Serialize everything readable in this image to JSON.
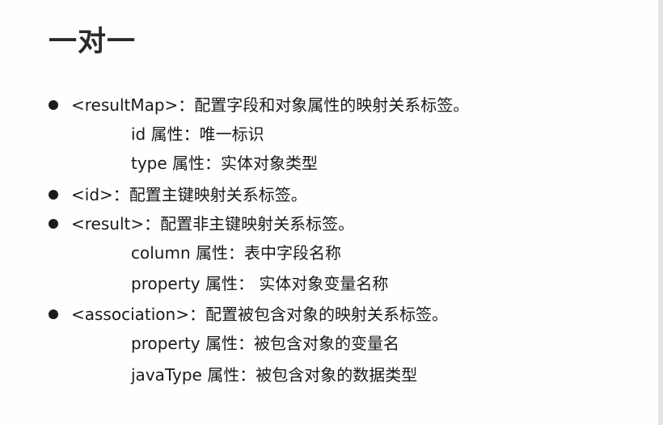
{
  "title": "一对一",
  "items": [
    {
      "text": "<resultMap>：配置字段和对象属性的映射关系标签。",
      "subs": [
        "id 属性：唯一标识",
        "type 属性：实体对象类型"
      ]
    },
    {
      "text": "<id>：配置主键映射关系标签。",
      "subs": []
    },
    {
      "text": "<result>：配置非主键映射关系标签。",
      "subs": [
        "column 属性：表中字段名称",
        "property 属性： 实体对象变量名称"
      ]
    },
    {
      "text": "<association>：配置被包含对象的映射关系标签。",
      "subs": [
        "property 属性：被包含对象的变量名",
        "javaType 属性：被包含对象的数据类型"
      ]
    }
  ]
}
